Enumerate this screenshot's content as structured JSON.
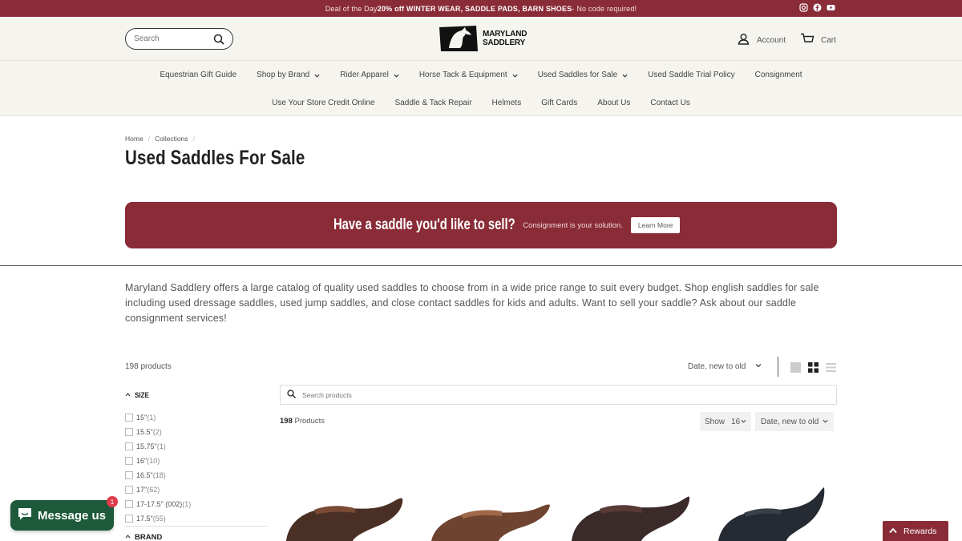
{
  "announcement": {
    "prefix": "Deal of the Day ",
    "highlight": "20% off WINTER WEAR, SADDLE PADS, BARN SHOES",
    "suffix": " - No code required!"
  },
  "header": {
    "search_placeholder": "Search",
    "logo_line1": "MARYLAND",
    "logo_line2": "SADDLERY",
    "account_label": "Account",
    "cart_label": "Cart"
  },
  "nav": {
    "row1": [
      {
        "label": "Equestrian Gift Guide",
        "dropdown": false
      },
      {
        "label": "Shop by Brand",
        "dropdown": true
      },
      {
        "label": "Rider Apparel",
        "dropdown": true
      },
      {
        "label": "Horse Tack & Equipment",
        "dropdown": true
      },
      {
        "label": "Used Saddles for Sale",
        "dropdown": true
      },
      {
        "label": "Used Saddle Trial Policy",
        "dropdown": false
      },
      {
        "label": "Consignment",
        "dropdown": false
      }
    ],
    "row2": [
      {
        "label": "Use Your Store Credit Online"
      },
      {
        "label": "Saddle & Tack Repair"
      },
      {
        "label": "Helmets"
      },
      {
        "label": "Gift Cards"
      },
      {
        "label": "About Us"
      },
      {
        "label": "Contact Us"
      }
    ]
  },
  "breadcrumb": {
    "home": "Home",
    "collections": "Collections",
    "sep": "/"
  },
  "page_title": "Used Saddles For Sale",
  "banner": {
    "heading": "Have a saddle you'd like to sell?",
    "subtext": "Consignment is your solution.",
    "button": "Learn More"
  },
  "description": "Maryland Saddlery offers a large catalog of quality used saddles to choose from in a wide price range to suit every budget. Shop english saddles for sale including used dressage saddles, used jump saddles, and close contact saddles for kids and adults. Want to sell your saddle? Ask about our saddle consignment services!",
  "toolbar": {
    "count": "198 products",
    "sort": "Date, new to old"
  },
  "filters": {
    "size_heading": "SIZE",
    "sizes": [
      {
        "label": "15\"",
        "count": "(1)"
      },
      {
        "label": "15.5\"",
        "count": "(2)"
      },
      {
        "label": "15.75\"",
        "count": "(1)"
      },
      {
        "label": "16\"",
        "count": "(10)"
      },
      {
        "label": "16.5\"",
        "count": "(18)"
      },
      {
        "label": "17\"",
        "count": "(62)"
      },
      {
        "label": "17-17.5\" (002)",
        "count": "(1)"
      },
      {
        "label": "17.5\"",
        "count": "(55)"
      }
    ],
    "brand_heading": "BRAND"
  },
  "products_area": {
    "search_placeholder": "Search products",
    "count_number": "198",
    "count_label": " Products",
    "show_label": "Show",
    "show_value": "16",
    "sort_value": "Date, new to old"
  },
  "chat": {
    "label": "Message us",
    "badge": "1"
  },
  "rewards": {
    "label": "Rewards"
  },
  "colors": {
    "brand": "#8a2c37",
    "chat": "#1d5a3b",
    "header_bg": "#f5f4ef"
  }
}
